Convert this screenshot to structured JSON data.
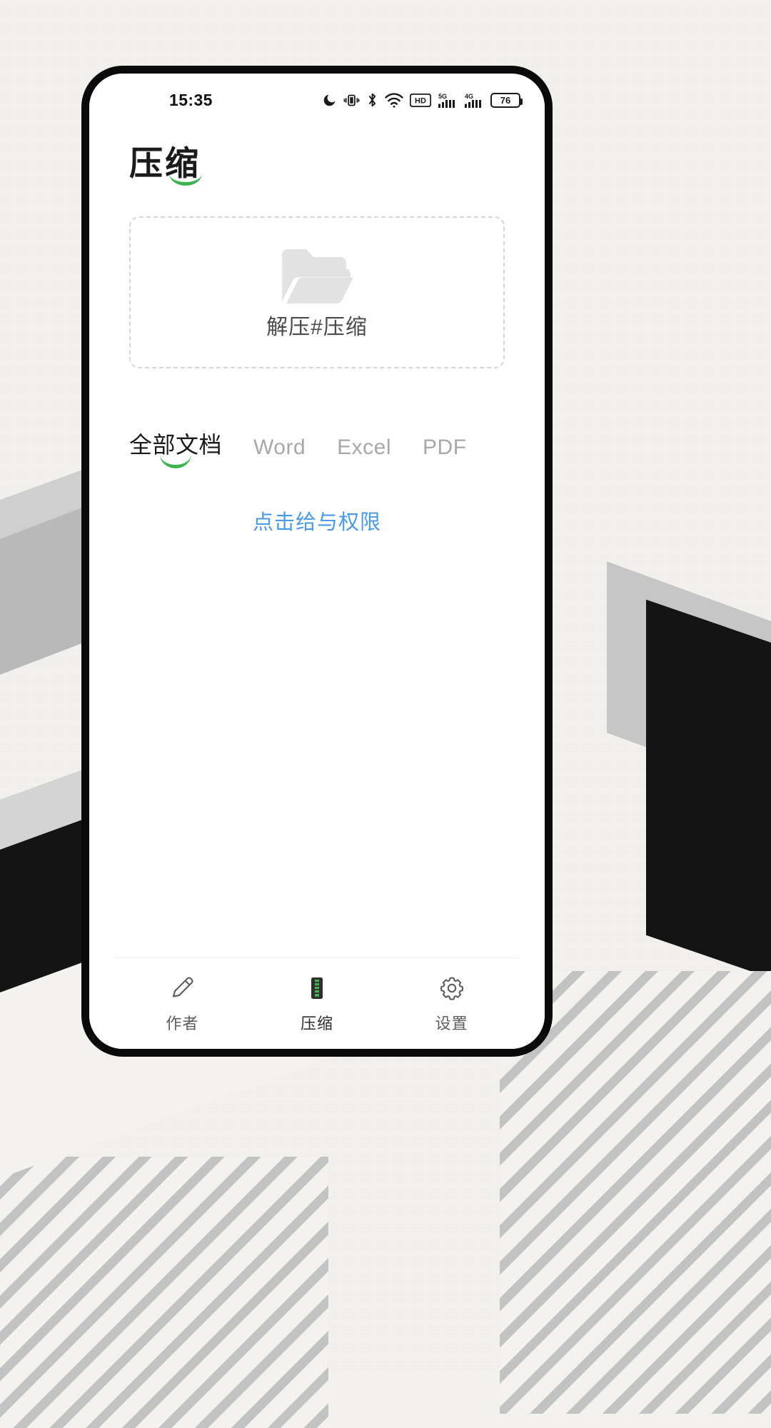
{
  "statusbar": {
    "time": "15:35",
    "battery_percent": "76",
    "icons": [
      "do-not-disturb-moon-icon",
      "vibrate-icon",
      "bluetooth-icon",
      "wifi-icon",
      "hd-voice-icon",
      "signal-5g-icon",
      "signal-4g-icon",
      "battery-icon"
    ],
    "network_5g_label": "5G",
    "network_4g_label": "4G",
    "hd_label": "HD"
  },
  "header": {
    "title": "压缩"
  },
  "dropzone": {
    "icon": "open-folder-icon",
    "label": "解压#压缩"
  },
  "filters": {
    "tabs": [
      {
        "label": "全部文档",
        "active": true
      },
      {
        "label": "Word",
        "active": false
      },
      {
        "label": "Excel",
        "active": false
      },
      {
        "label": "PDF",
        "active": false
      }
    ]
  },
  "permission": {
    "link_label": "点击给与权限"
  },
  "bottom_nav": {
    "items": [
      {
        "label": "作者",
        "icon": "pencil-edit-icon",
        "active": false
      },
      {
        "label": "压缩",
        "icon": "zip-file-icon",
        "active": true
      },
      {
        "label": "设置",
        "icon": "gear-icon",
        "active": false
      }
    ]
  },
  "colors": {
    "accent_green": "#3eb34f",
    "link_blue": "#4a9ae8",
    "text_dark": "#1b1b1b",
    "text_muted": "#a8a8a8",
    "dropzone_border": "#d6d6d6"
  }
}
